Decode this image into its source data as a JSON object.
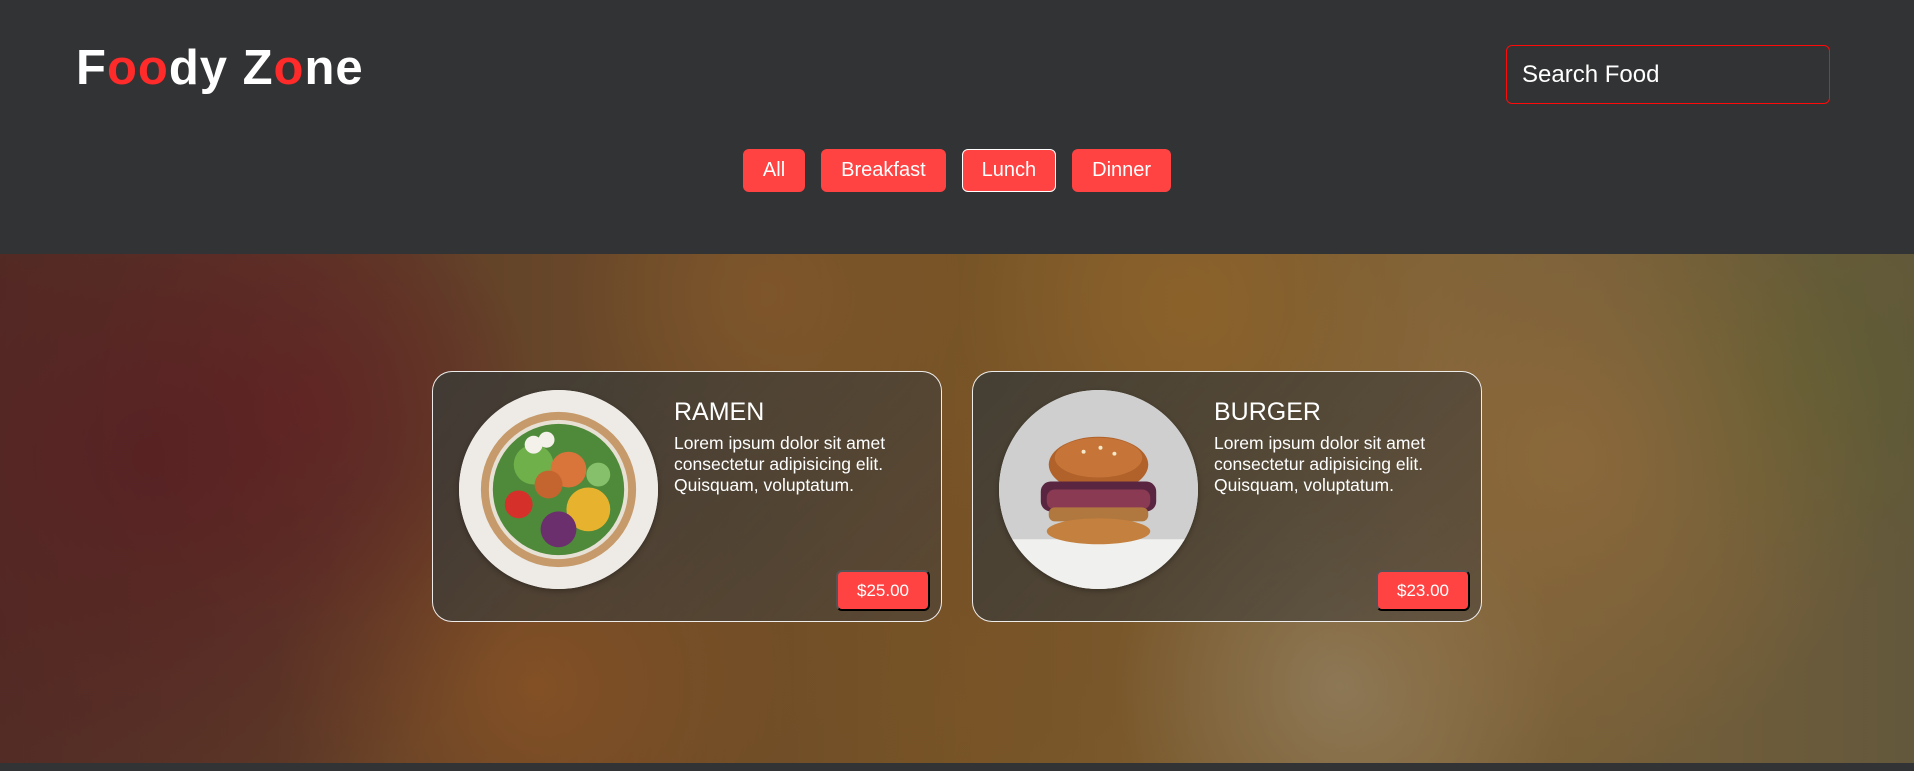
{
  "header": {
    "logo": {
      "parts": [
        {
          "text": "F",
          "accent": false
        },
        {
          "text": "oo",
          "accent": true
        },
        {
          "text": "dy Z",
          "accent": false
        },
        {
          "text": "o",
          "accent": true
        },
        {
          "text": "ne",
          "accent": false
        }
      ]
    },
    "search": {
      "placeholder": "Search Food",
      "value": ""
    },
    "filters": [
      {
        "label": "All",
        "active": false
      },
      {
        "label": "Breakfast",
        "active": false
      },
      {
        "label": "Lunch",
        "active": true
      },
      {
        "label": "Dinner",
        "active": false
      }
    ]
  },
  "foods": [
    {
      "name": "RAMEN",
      "description": "Lorem ipsum dolor sit amet consectetur adipisicing elit. Quisquam, voluptatum.",
      "price": "$25.00",
      "image_icon": "salad-bowl-icon"
    },
    {
      "name": "BURGER",
      "description": "Lorem ipsum dolor sit amet consectetur adipisicing elit. Quisquam, voluptatum.",
      "price": "$23.00",
      "image_icon": "burger-icon"
    }
  ],
  "colors": {
    "accent": "#ff4343",
    "logo_accent": "#ff2a2a",
    "header_bg": "#323334",
    "search_border": "#ff0909"
  }
}
